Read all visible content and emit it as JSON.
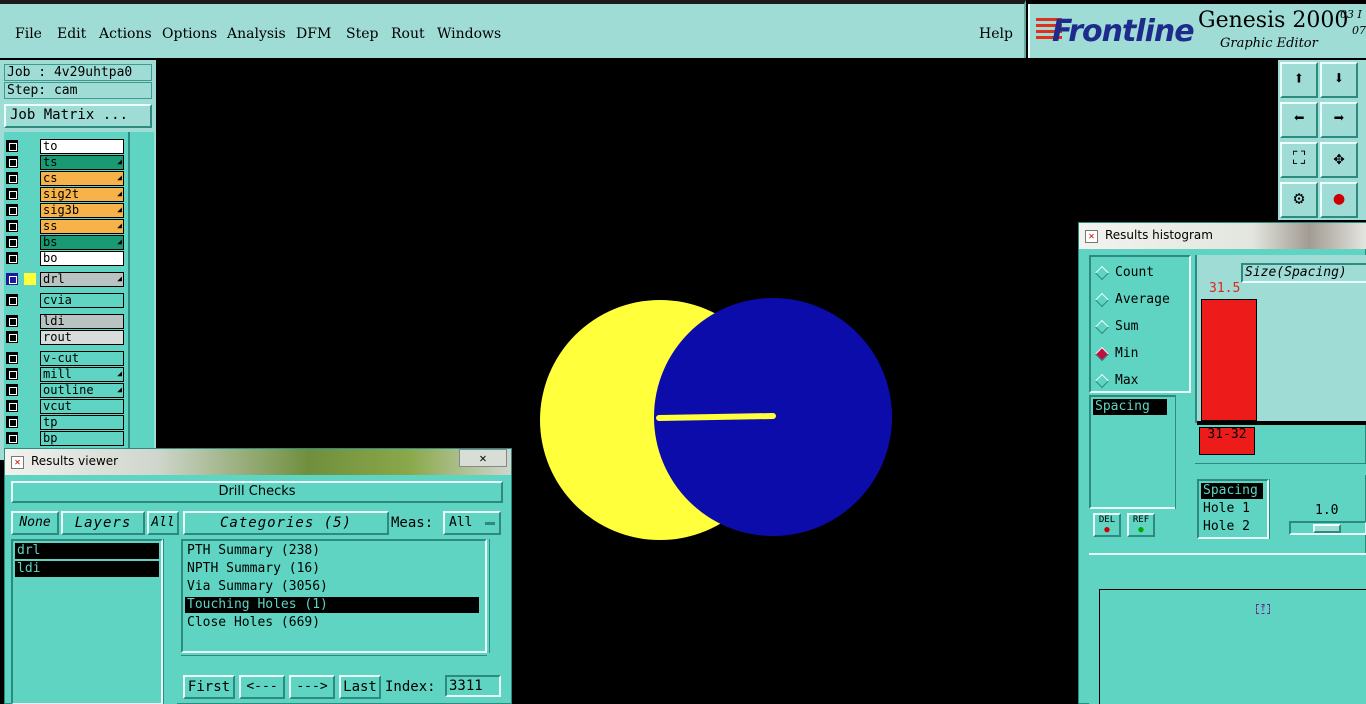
{
  "menubar": {
    "items": [
      "File",
      "Edit",
      "Actions",
      "Options",
      "Analysis",
      "DFM",
      "Step",
      "Rout",
      "Windows"
    ],
    "help": "Help"
  },
  "brand": {
    "logo": "Frontline",
    "product": "Genesis 2000",
    "subtitle": "Graphic Editor",
    "version_top": "03 I",
    "version_bottom": "07"
  },
  "job": {
    "job_line": "Job : 4v29uhtpa0",
    "step_line": "Step: cam",
    "matrix_button": "Job Matrix ..."
  },
  "layers": [
    {
      "name": "to",
      "color": "#ffffff",
      "arrow": false
    },
    {
      "name": "ts",
      "color": "#1a9a74",
      "arrow": true
    },
    {
      "name": "cs",
      "color": "#f7b34a",
      "arrow": true
    },
    {
      "name": "sig2t",
      "color": "#f7b34a",
      "arrow": true
    },
    {
      "name": "sig3b",
      "color": "#f7b34a",
      "arrow": true
    },
    {
      "name": "ss",
      "color": "#f7b34a",
      "arrow": true
    },
    {
      "name": "bs",
      "color": "#1a9a74",
      "arrow": true
    },
    {
      "name": "bo",
      "color": "#ffffff",
      "arrow": false
    },
    {
      "name": "drl",
      "color": "#b9c4c2",
      "arrow": true
    },
    {
      "name": "cvia",
      "color": "#5fd4c2",
      "arrow": false
    },
    {
      "name": "ldi",
      "color": "#b9c4c2",
      "arrow": false
    },
    {
      "name": "rout",
      "color": "#d8dcdb",
      "arrow": false
    },
    {
      "name": "v-cut",
      "color": "#5fd4c2",
      "arrow": false
    },
    {
      "name": "mill",
      "color": "#5fd4c2",
      "arrow": true
    },
    {
      "name": "outline",
      "color": "#5fd4c2",
      "arrow": true
    },
    {
      "name": "vcut",
      "color": "#5fd4c2",
      "arrow": false
    },
    {
      "name": "tp",
      "color": "#5fd4c2",
      "arrow": false
    },
    {
      "name": "bp",
      "color": "#5fd4c2",
      "arrow": false
    }
  ],
  "results_viewer": {
    "title": "Results viewer",
    "close": "✕",
    "header": "Drill Checks",
    "none_btn": "None",
    "layers_btn": "Layers",
    "all_btn": "All",
    "categories_btn": "Categories (5)",
    "meas_label": "Meas:",
    "meas_value": "All",
    "layer_items": [
      "drl",
      "ldi"
    ],
    "category_items": [
      "PTH Summary (238)",
      "NPTH Summary (16)",
      "Via Summary (3056)",
      "Touching Holes (1)",
      "Close Holes (669)"
    ],
    "selected_category": 3,
    "first_btn": "First",
    "prev_btn": "<---",
    "next_btn": "--->",
    "last_btn": "Last",
    "index_label": "Index:",
    "index_value": "3311"
  },
  "histogram": {
    "title": "Results histogram",
    "options": [
      "Count",
      "Average",
      "Sum",
      "Min",
      "Max"
    ],
    "selected_option": 3,
    "size_label": "Size(Spacing)",
    "bar_value": "31.5",
    "bar_category": "31-32",
    "bar_color": "#ee1b1b",
    "left_list": [
      "Spacing"
    ],
    "del_btn": "DEL",
    "ref_btn": "REF",
    "bottom_list": [
      "Spacing",
      "Hole 1",
      "Hole 2"
    ],
    "slider_value": "1.0"
  },
  "toolbar": {
    "icons": [
      "pan-up-icon",
      "pan-down-icon",
      "pan-left-icon",
      "pan-right-icon",
      "zoom-fit-icon",
      "zoom-center-icon",
      "measure-icon",
      "snap-icon"
    ]
  },
  "canvas": {
    "pad_color_yellow": "#ffff3c",
    "pad_color_blue": "#0c0caa"
  }
}
